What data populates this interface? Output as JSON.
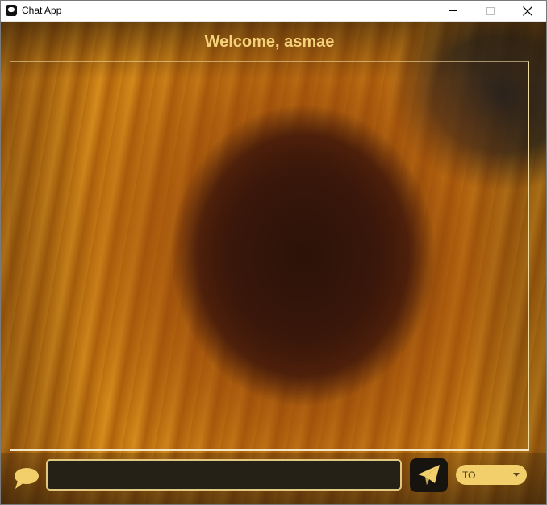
{
  "window": {
    "title": "Chat App",
    "controls": {
      "minimize": "minimize",
      "maximize": "maximize",
      "close": "close"
    }
  },
  "header": {
    "welcome": "Welcome, asmae"
  },
  "messages": [],
  "composer": {
    "message_value": "",
    "placeholder": ""
  },
  "recipient": {
    "selected": "TO"
  },
  "icons": {
    "app": "app-icon",
    "chat": "chat-bubble-icon",
    "send": "paper-plane-icon",
    "dropdown": "chevron-down-icon"
  },
  "colors": {
    "accent": "#f5d27a",
    "input_bg": "#262117",
    "send_bg": "#17130f",
    "select_bg": "#f2cf6b"
  }
}
